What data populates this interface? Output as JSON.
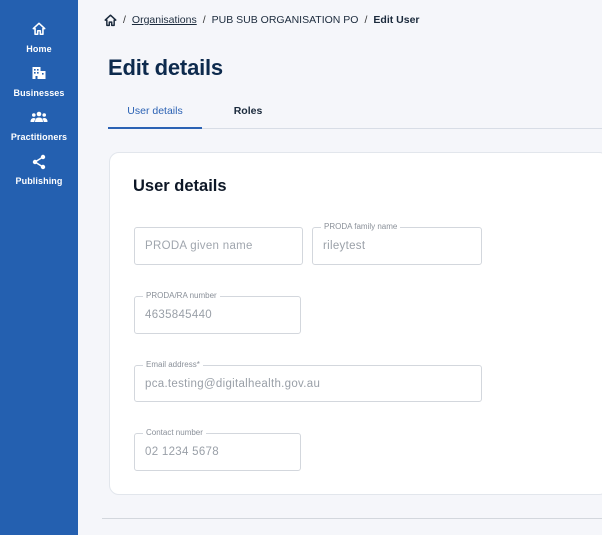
{
  "sidebar": {
    "items": [
      {
        "label": "Home",
        "icon": "home-icon"
      },
      {
        "label": "Businesses",
        "icon": "building-icon"
      },
      {
        "label": "Practitioners",
        "icon": "people-icon"
      },
      {
        "label": "Publishing",
        "icon": "share-icon"
      }
    ],
    "background": "#2460b0"
  },
  "breadcrumb": {
    "home_icon": "home-icon",
    "separator": "/",
    "items": [
      "Organisations",
      "PUB SUB ORGANISATION PO",
      "Edit User"
    ]
  },
  "page": {
    "title": "Edit details"
  },
  "tabs": [
    {
      "label": "User details",
      "active": true
    },
    {
      "label": "Roles",
      "active": false
    }
  ],
  "card": {
    "title": "User details",
    "fields": {
      "given_name": {
        "label": "",
        "placeholder": "PRODA given name",
        "value": ""
      },
      "family_name": {
        "label": "PRODA family name",
        "value": "rileytest"
      },
      "proda_number": {
        "label": "PRODA/RA number",
        "value": "4635845440"
      },
      "email": {
        "label": "Email address*",
        "value": "pca.testing@digitalhealth.gov.au"
      },
      "contact_number": {
        "label": "Contact number",
        "value": "02 1234 5678"
      }
    }
  },
  "colors": {
    "accent": "#2b62b4",
    "title": "#0d2a4d"
  }
}
